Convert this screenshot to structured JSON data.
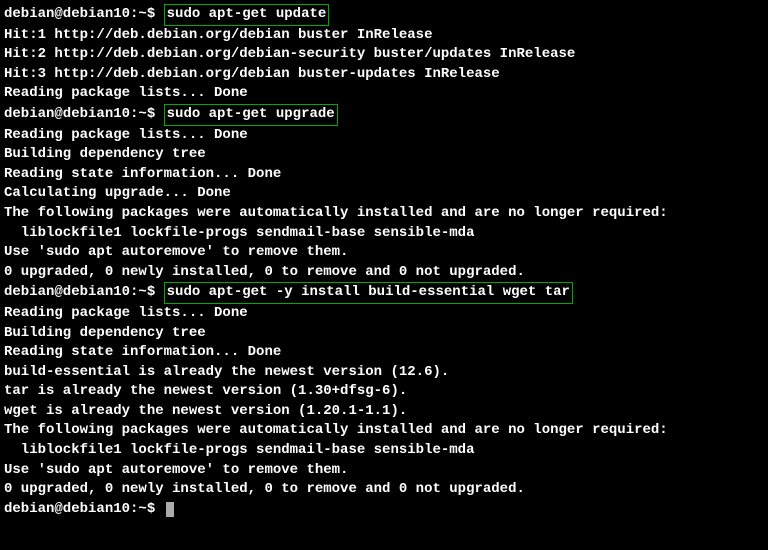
{
  "lines": [
    {
      "prompt": "debian@debian10:~$ ",
      "cmd": "sudo apt-get update"
    },
    {
      "text": "Hit:1 http://deb.debian.org/debian buster InRelease"
    },
    {
      "text": "Hit:2 http://deb.debian.org/debian-security buster/updates InRelease"
    },
    {
      "text": "Hit:3 http://deb.debian.org/debian buster-updates InRelease"
    },
    {
      "text": "Reading package lists... Done"
    },
    {
      "prompt": "debian@debian10:~$ ",
      "cmd": "sudo apt-get upgrade"
    },
    {
      "text": "Reading package lists... Done"
    },
    {
      "text": "Building dependency tree"
    },
    {
      "text": "Reading state information... Done"
    },
    {
      "text": "Calculating upgrade... Done"
    },
    {
      "text": "The following packages were automatically installed and are no longer required:"
    },
    {
      "text": "  liblockfile1 lockfile-progs sendmail-base sensible-mda"
    },
    {
      "text": "Use 'sudo apt autoremove' to remove them."
    },
    {
      "text": "0 upgraded, 0 newly installed, 0 to remove and 0 not upgraded."
    },
    {
      "prompt": "debian@debian10:~$ ",
      "cmd": "sudo apt-get -y install build-essential wget tar"
    },
    {
      "text": "Reading package lists... Done"
    },
    {
      "text": "Building dependency tree"
    },
    {
      "text": "Reading state information... Done"
    },
    {
      "text": "build-essential is already the newest version (12.6)."
    },
    {
      "text": "tar is already the newest version (1.30+dfsg-6)."
    },
    {
      "text": "wget is already the newest version (1.20.1-1.1)."
    },
    {
      "text": "The following packages were automatically installed and are no longer required:"
    },
    {
      "text": "  liblockfile1 lockfile-progs sendmail-base sensible-mda"
    },
    {
      "text": "Use 'sudo apt autoremove' to remove them."
    },
    {
      "text": "0 upgraded, 0 newly installed, 0 to remove and 0 not upgraded."
    },
    {
      "prompt": "debian@debian10:~$ ",
      "cursor": true
    }
  ]
}
